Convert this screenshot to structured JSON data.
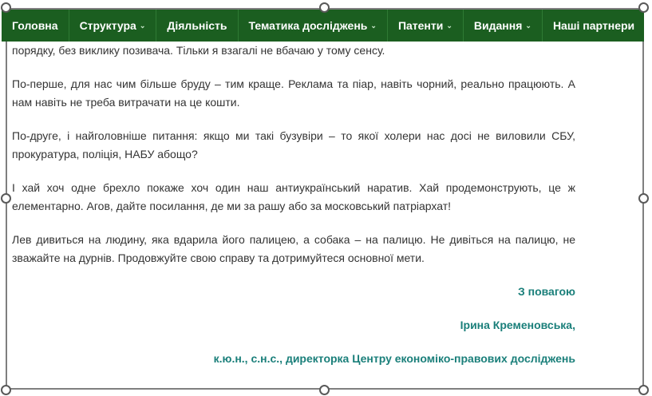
{
  "nav": {
    "items": [
      {
        "label": "Головна",
        "caret": ""
      },
      {
        "label": "Структура",
        "caret": "⌄"
      },
      {
        "label": "Діяльність",
        "caret": ""
      },
      {
        "label": "Тематика досліджень",
        "caret": "⌄"
      },
      {
        "label": "Патенти",
        "caret": "⌄"
      },
      {
        "label": "Видання",
        "caret": "⌄"
      },
      {
        "label": "Наші партнери",
        "caret": ""
      }
    ]
  },
  "article": {
    "paragraphs": [
      "порядку, без виклику позивача. Тільки я взагалі не вбачаю у тому сенсу.",
      "По-перше, для нас чим більше бруду – тим краще. Реклама та піар, навіть чорний, реально працюють. А нам навіть не треба витрачати на це кошти.",
      "По-друге, і найголовніше питання: якщо ми такі бузувіри – то якої холери нас досі не виловили СБУ, прокуратура, поліція, НАБУ абощо?",
      "І хай хоч одне брехло покаже хоч один наш антиукраїнський наратив. Хай продемонструють, це ж елементарно. Агов, дайте посилання, де ми за рашу або за московський патріархат!",
      "Лев дивиться на людину, яка вдарила його палицею, а собака – на палицю. Не дивіться на палицю, не зважайте на дурнів. Продовжуйте свою справу та дотримуйтеся основної мети."
    ],
    "signature": {
      "greeting": "З повагою",
      "name": "Ірина Кременовська,",
      "title": "к.ю.н., с.н.с., директорка Центру економіко-правових досліджень"
    }
  },
  "colors": {
    "nav_bg": "#1b5e20",
    "signature": "#1a7f7a",
    "text": "#333333"
  }
}
